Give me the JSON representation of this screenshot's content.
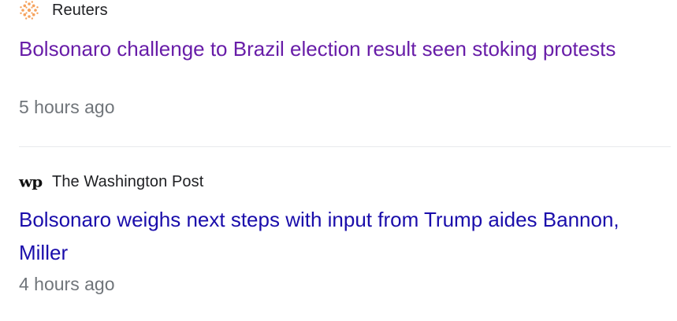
{
  "articles": [
    {
      "source": "Reuters",
      "source_icon": "reuters-logo-icon",
      "headline": "Bolsonaro challenge to Brazil election result seen stoking protests",
      "time": "5 hours ago",
      "link_color": "#681da8"
    },
    {
      "source": "The Washington Post",
      "source_icon": "washington-post-logo-icon",
      "logo_text": "wp",
      "headline": "Bolsonaro weighs next steps with input from Trump aides Bannon, Miller",
      "time": "4 hours ago",
      "link_color": "#1a0dab"
    }
  ]
}
